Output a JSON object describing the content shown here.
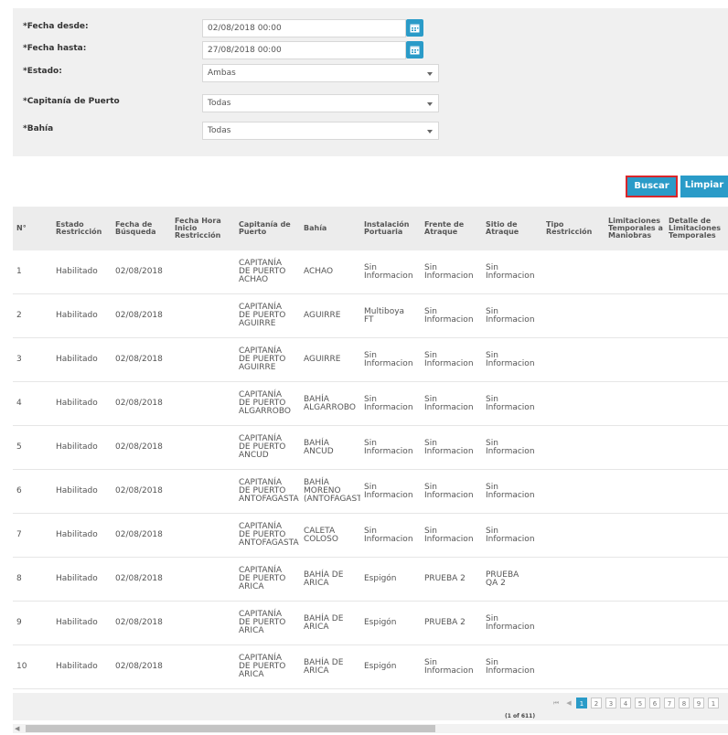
{
  "form": {
    "fecha_desde": {
      "label": "*Fecha desde:",
      "value": "02/08/2018 00:00"
    },
    "fecha_hasta": {
      "label": "*Fecha hasta:",
      "value": "27/08/2018 00:00"
    },
    "estado": {
      "label": "*Estado:",
      "value": "Ambas"
    },
    "capitania": {
      "label": "*Capitanía de Puerto",
      "value": "Todas"
    },
    "bahia": {
      "label": "*Bahía",
      "value": "Todas"
    }
  },
  "buttons": {
    "buscar": "Buscar",
    "limpiar": "Limpiar"
  },
  "table": {
    "columns": [
      "N°",
      "Estado Restricción",
      "Fecha de Búsqueda",
      "Fecha Hora Inicio Restricción",
      "Capitanía de Puerto",
      "Bahía",
      "Instalación Portuaria",
      "Frente de Atraque",
      "Sitio de Atraque",
      "Tipo Restricción",
      "Limitaciones Temporales a Maniobras",
      "Detalle de Limitaciones Temporales"
    ],
    "rows": [
      [
        "1",
        "Habilitado",
        "02/08/2018",
        "",
        "CAPITANÍA\nDE PUERTO\nACHAO",
        "ACHAO",
        "Sin\nInformacion",
        "Sin\nInformacion",
        "Sin\nInformacion",
        "",
        "",
        ""
      ],
      [
        "2",
        "Habilitado",
        "02/08/2018",
        "",
        "CAPITANÍA\nDE PUERTO\nAGUIRRE",
        "AGUIRRE",
        "Multiboya\nFT",
        "Sin\nInformacion",
        "Sin\nInformacion",
        "",
        "",
        ""
      ],
      [
        "3",
        "Habilitado",
        "02/08/2018",
        "",
        "CAPITANÍA\nDE PUERTO\nAGUIRRE",
        "AGUIRRE",
        "Sin\nInformacion",
        "Sin\nInformacion",
        "Sin\nInformacion",
        "",
        "",
        ""
      ],
      [
        "4",
        "Habilitado",
        "02/08/2018",
        "",
        "CAPITANÍA\nDE PUERTO\nALGARROBO",
        "BAHÍA\nALGARROBO",
        "Sin\nInformacion",
        "Sin\nInformacion",
        "Sin\nInformacion",
        "",
        "",
        ""
      ],
      [
        "5",
        "Habilitado",
        "02/08/2018",
        "",
        "CAPITANÍA\nDE PUERTO\nANCUD",
        "BAHÍA\nANCUD",
        "Sin\nInformacion",
        "Sin\nInformacion",
        "Sin\nInformacion",
        "",
        "",
        ""
      ],
      [
        "6",
        "Habilitado",
        "02/08/2018",
        "",
        "CAPITANÍA\nDE PUERTO\nANTOFAGASTA",
        "BAHÍA\nMORENO\n(ANTOFAGASTA",
        "Sin\nInformacion",
        "Sin\nInformacion",
        "Sin\nInformacion",
        "",
        "",
        ""
      ],
      [
        "7",
        "Habilitado",
        "02/08/2018",
        "",
        "CAPITANÍA\nDE PUERTO\nANTOFAGASTA",
        "CALETA\nCOLOSO",
        "Sin\nInformacion",
        "Sin\nInformacion",
        "Sin\nInformacion",
        "",
        "",
        ""
      ],
      [
        "8",
        "Habilitado",
        "02/08/2018",
        "",
        "CAPITANÍA\nDE PUERTO\nARICA",
        "BAHÍA DE\nARICA",
        "Espigón",
        "PRUEBA 2",
        "PRUEBA\nQA 2",
        "",
        "",
        ""
      ],
      [
        "9",
        "Habilitado",
        "02/08/2018",
        "",
        "CAPITANÍA\nDE PUERTO\nARICA",
        "BAHÍA DE\nARICA",
        "Espigón",
        "PRUEBA 2",
        "Sin\nInformacion",
        "",
        "",
        ""
      ],
      [
        "10",
        "Habilitado",
        "02/08/2018",
        "",
        "CAPITANÍA\nDE PUERTO\nARICA",
        "BAHÍA DE\nARICA",
        "Espigón",
        "Sin\nInformacion",
        "Sin\nInformacion",
        "",
        "",
        ""
      ]
    ]
  },
  "pager": {
    "info": "(1 of 611)",
    "first": "⏮",
    "prev": "◀",
    "pages": [
      "1",
      "2",
      "3",
      "4",
      "5",
      "6",
      "7",
      "8",
      "9",
      "1"
    ],
    "active_page": "1"
  },
  "scrollbar": {
    "left_arrow": "◀"
  }
}
